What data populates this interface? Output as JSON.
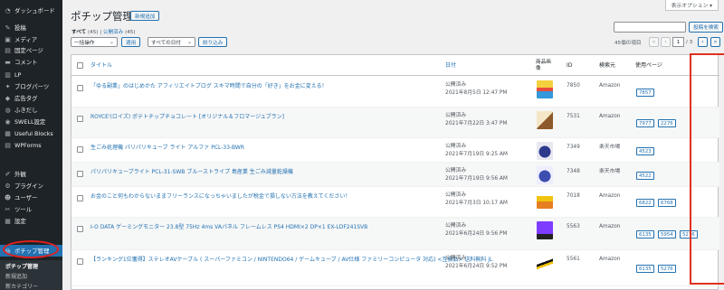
{
  "sidebar": {
    "items": [
      {
        "label": "ダッシュボード",
        "icon": "dashboard-icon",
        "glyph": "◔"
      },
      {
        "label": "投稿",
        "icon": "pin-icon",
        "glyph": "✎"
      },
      {
        "label": "メディア",
        "icon": "media-icon",
        "glyph": "▣"
      },
      {
        "label": "固定ページ",
        "icon": "page-icon",
        "glyph": "▤"
      },
      {
        "label": "コメント",
        "icon": "comment-icon",
        "glyph": "▬"
      },
      {
        "label": "LP",
        "icon": "lp-icon",
        "glyph": "▥"
      },
      {
        "label": "ブログパーツ",
        "icon": "blog-parts-icon",
        "glyph": "✦"
      },
      {
        "label": "広告タグ",
        "icon": "ad-tag-icon",
        "glyph": "◆"
      },
      {
        "label": "ふきだし",
        "icon": "balloon-icon",
        "glyph": "◍"
      },
      {
        "label": "SWELL設定",
        "icon": "swell-icon",
        "glyph": "◉"
      },
      {
        "label": "Useful Blocks",
        "icon": "blocks-icon",
        "glyph": "▦"
      },
      {
        "label": "WPForms",
        "icon": "forms-icon",
        "glyph": "▤"
      },
      {
        "label": "外観",
        "icon": "appearance-icon",
        "glyph": "✐"
      },
      {
        "label": "プラグイン",
        "icon": "plugin-icon",
        "glyph": "⚙"
      },
      {
        "label": "ユーザー",
        "icon": "user-icon",
        "glyph": "☻"
      },
      {
        "label": "ツール",
        "icon": "tool-icon",
        "glyph": "✂"
      },
      {
        "label": "設定",
        "icon": "settings-icon",
        "glyph": "▦"
      },
      {
        "label": "ポチップ管理",
        "icon": "pochipp-icon",
        "glyph": "◎"
      }
    ],
    "submenu": [
      {
        "label": "ポチップ管理"
      },
      {
        "label": "新規追加"
      },
      {
        "label": "新カテゴリー"
      }
    ]
  },
  "header": {
    "screen_options": "表示オプション ▾",
    "page_title": "ポチップ管理",
    "add_new": "新規追加"
  },
  "views": {
    "all_label": "すべて",
    "all_count": "(45)",
    "sep": "|",
    "published_label": "公開済み",
    "published_count": "(45)"
  },
  "bulk": {
    "action": "一括操作",
    "apply": "適用",
    "date": "すべての日付",
    "filter": "絞り込み"
  },
  "search": {
    "button": "投稿を検索",
    "value": ""
  },
  "pagination": {
    "items": "45個の項目",
    "first": "«",
    "prev": "‹",
    "current": "1",
    "total": "/ 3",
    "next": "›",
    "last": "»"
  },
  "table": {
    "headers": {
      "title": "タイトル",
      "date": "日付",
      "image": "商品画像",
      "id": "ID",
      "shop": "検索元",
      "used": "使用ページ"
    },
    "rows": [
      {
        "title": "「ゆる副業」のはじめかた アフィリエイトブログ スキマ時間で自分の「好き」をお金に変える！",
        "status": "公開済み",
        "date": "2021年8月5日 12:47 PM",
        "id": "7850",
        "shop": "Amazon",
        "pages": [
          "7857"
        ],
        "thumb": "book"
      },
      {
        "title": "ROYCE'(ロイズ) ポテトチップチョコレート [オリジナル＆フロマージュブラン]",
        "status": "公開済み",
        "date": "2021年7月22日 3:47 PM",
        "id": "7531",
        "shop": "Amazon",
        "pages": [
          "7977",
          "2276"
        ],
        "thumb": "chips"
      },
      {
        "title": "生ごみ処理機 パリパリキューブ ライト アルファ PCL-33-BWR",
        "status": "公開済み",
        "date": "2021年7月19日 9:25 AM",
        "id": "7349",
        "shop": "楽天市場",
        "pages": [
          "4523"
        ],
        "thumb": "cube"
      },
      {
        "title": "パリパリキューブライト PCL-31-SWB ブルーストライプ 島産業 生ごみ減量乾燥機",
        "status": "公開済み",
        "date": "2021年7月19日 9:56 AM",
        "id": "7348",
        "shop": "楽天市場",
        "pages": [
          "4522"
        ],
        "thumb": "cube2"
      },
      {
        "title": "お金のこと何もわからないままフリーランスになっちゃいましたが税金で損しない方法を教えてください！",
        "status": "公開済み",
        "date": "2021年7月3日 10:17 AM",
        "id": "7018",
        "shop": "Amazon",
        "pages": [
          "6822",
          "6768"
        ],
        "thumb": "book2"
      },
      {
        "title": "I-O DATA ゲーミングモニター 23.8型 75Hz 4ms VAパネル フレームレス PS4 HDMI×2 DP×1 EX-LDF241SVB",
        "status": "公開済み",
        "date": "2021年6月24日 9:56 PM",
        "id": "5563",
        "shop": "Amazon",
        "pages": [
          "6135",
          "5954",
          "5276"
        ],
        "thumb": "monitor"
      },
      {
        "title": "【ランキング1位獲得】ステレオAVケーブル ( スーパーファミコン / NINTENDO64 / ゲームキューブ / AV仕様 ファミリーコンピュータ 対応) <互換品> 送料無料 jL",
        "status": "公開済み",
        "date": "2021年6月24日 9:52 PM",
        "id": "5561",
        "shop": "Amazon",
        "pages": [
          "6135",
          "5276"
        ],
        "thumb": "cable"
      }
    ]
  },
  "colors": {
    "accent": "#2271b1",
    "sidebar_bg": "#1d2327",
    "highlight": "#e0301e"
  }
}
